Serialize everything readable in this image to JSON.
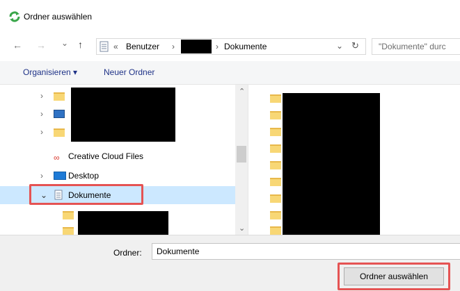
{
  "window": {
    "title": "Ordner auswählen",
    "icon": "refresh-green-icon"
  },
  "nav": {
    "back": "←",
    "forward": "→",
    "recent": "⌄",
    "up": "↑",
    "address": {
      "prefix": "«",
      "items": [
        "Benutzer",
        "Dokumente"
      ],
      "dropdown": "⌄",
      "refresh": "↻"
    },
    "search_placeholder": "\"Dokumente\" durc"
  },
  "toolbar": {
    "organize": "Organisieren ▾",
    "new_folder": "Neuer Ordner"
  },
  "tree": {
    "items": [
      {
        "label": "",
        "expander": "›"
      },
      {
        "label": "",
        "expander": "›"
      },
      {
        "label": "",
        "expander": "›"
      },
      {
        "label": "Creative Cloud Files",
        "expander": ""
      },
      {
        "label": "Desktop",
        "expander": "›"
      },
      {
        "label": "Dokumente",
        "expander": "⌄"
      }
    ],
    "scroll_up": "⌃",
    "scroll_down": "⌄"
  },
  "footer": {
    "folder_label": "Ordner:",
    "folder_value": "Dokumente",
    "select_button": "Ordner auswählen"
  },
  "colors": {
    "accent": "#1e3287",
    "highlight": "#e55353",
    "selected_row": "#cce8ff"
  }
}
